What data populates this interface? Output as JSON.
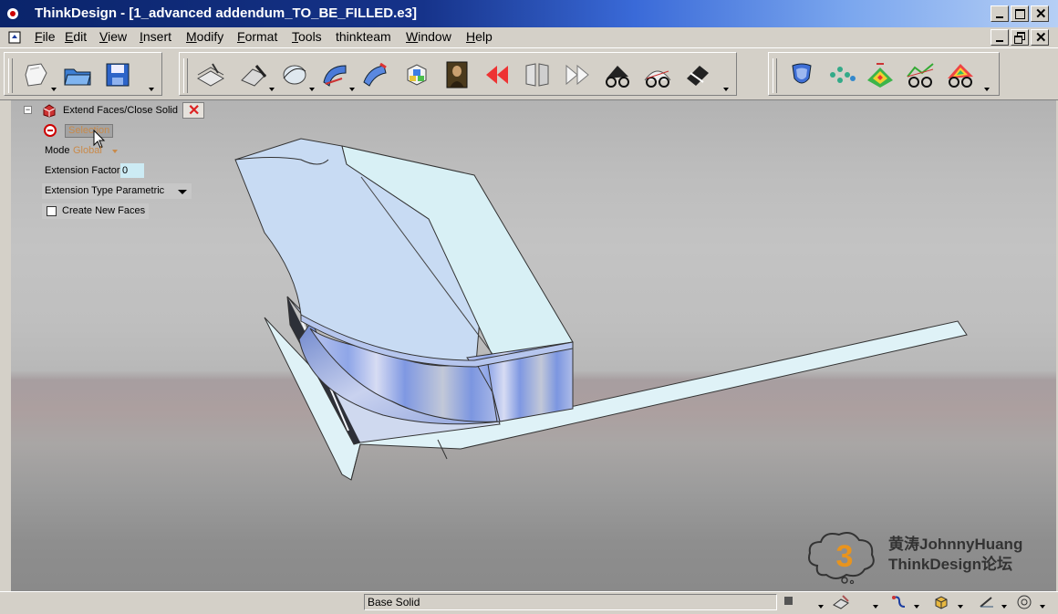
{
  "window": {
    "title": "ThinkDesign  - [1_advanced addendum_TO_BE_FILLED.e3]"
  },
  "menu": {
    "items": [
      {
        "label": "File",
        "u": "F",
        "rest": "ile"
      },
      {
        "label": "Edit",
        "u": "E",
        "rest": "dit"
      },
      {
        "label": "View",
        "u": "V",
        "rest": "iew"
      },
      {
        "label": "Insert",
        "u": "I",
        "rest": "nsert"
      },
      {
        "label": "Modify",
        "u": "M",
        "rest": "odify"
      },
      {
        "label": "Format",
        "u": "F",
        "rest": "ormat"
      },
      {
        "label": "Tools",
        "u": "T",
        "rest": "ools"
      },
      {
        "label": "thinkteam",
        "u": "",
        "rest": "thinkteam"
      },
      {
        "label": "Window",
        "u": "W",
        "rest": "indow"
      },
      {
        "label": "Help",
        "u": "H",
        "rest": "elp"
      }
    ]
  },
  "toolbar": {
    "icons": [
      "new-icon",
      "open-folder-icon",
      "save-icon",
      "sketch-icon",
      "draw-icon",
      "curve-icon",
      "surface-icon",
      "sweep-icon",
      "solid-cube-icon",
      "mona-lisa-icon",
      "rewind-icon",
      "split-icon",
      "forward-icon",
      "glasses-icon",
      "analysis-icon",
      "pen-icon",
      "shield-icon",
      "points-icon",
      "color-map-icon",
      "glasses-graph-icon",
      "colored-glasses-icon"
    ]
  },
  "panel": {
    "command_title": "Extend Faces/Close Solid",
    "select_label": "Selection",
    "mode_label": "Mode",
    "mode_value": "Global",
    "extension_factor_label": "Extension Factor",
    "extension_factor_value": "0",
    "extension_type_label": "Extension Type",
    "extension_type_value": "Parametric",
    "create_new_faces_label": "Create New Faces",
    "create_new_faces_checked": false
  },
  "watermark": {
    "line1": "黄涛JohnnyHuang",
    "line2": "ThinkDesign论坛",
    "logo_digit": "3"
  },
  "status": {
    "text": "Base Solid"
  }
}
